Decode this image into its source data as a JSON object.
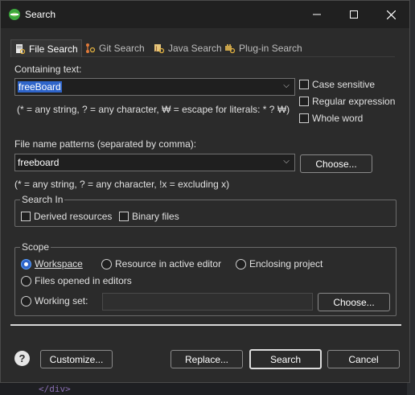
{
  "window": {
    "title": "Search"
  },
  "tabs": [
    {
      "label": "File Search",
      "active": true
    },
    {
      "label": "Git Search",
      "active": false
    },
    {
      "label": "Java Search",
      "active": false
    },
    {
      "label": "Plug-in Search",
      "active": false
    }
  ],
  "containing": {
    "label": "Containing text:",
    "value": "freeBoard",
    "hint": "(* = any string, ? = any character, ₩ = escape for literals: * ? ₩)"
  },
  "options": {
    "case_sensitive": "Case sensitive",
    "regular_expression": "Regular expression",
    "whole_word": "Whole word"
  },
  "patterns": {
    "label": "File name patterns (separated by comma):",
    "value": "freeboard",
    "choose": "Choose...",
    "hint": "(* = any string, ? = any character, !x = excluding x)"
  },
  "search_in": {
    "title": "Search In",
    "derived": "Derived resources",
    "binary": "Binary files"
  },
  "scope": {
    "title": "Scope",
    "workspace": "Workspace",
    "resource_active": "Resource in active editor",
    "enclosing": "Enclosing project",
    "files_opened": "Files opened in editors",
    "working_set": "Working set:",
    "working_set_value": "",
    "choose": "Choose..."
  },
  "buttons": {
    "customize": "Customize...",
    "replace": "Replace...",
    "search": "Search",
    "cancel": "Cancel"
  },
  "background_code": "</div>",
  "colors": {
    "accent": "#2f65ca",
    "dialog_bg": "#2b2b2b",
    "title_bg": "#202020"
  }
}
